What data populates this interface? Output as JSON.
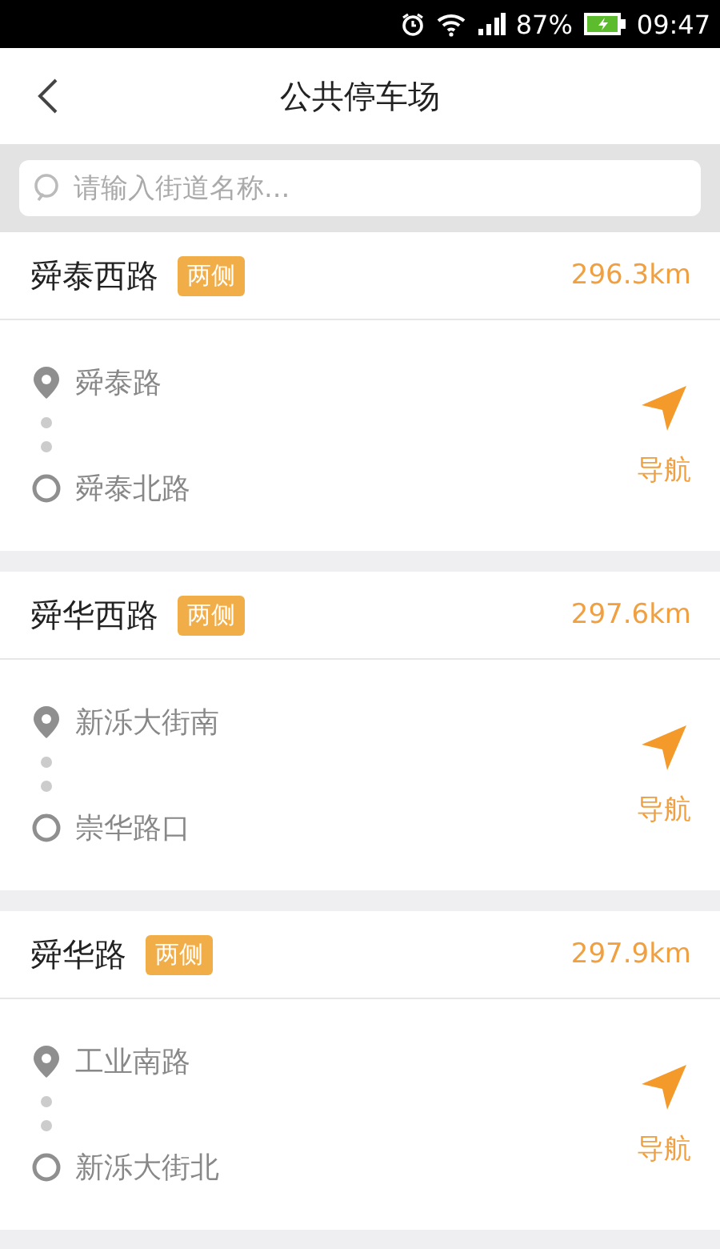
{
  "status_bar": {
    "battery": "87%",
    "time": "09:47"
  },
  "header": {
    "title": "公共停车场"
  },
  "search": {
    "placeholder": "请输入街道名称..."
  },
  "parkings": [
    {
      "name": "舜泰西路",
      "tag": "两侧",
      "distance": "296.3km",
      "start": "舜泰路",
      "end": "舜泰北路",
      "nav": "导航"
    },
    {
      "name": "舜华西路",
      "tag": "两侧",
      "distance": "297.6km",
      "start": "新泺大街南",
      "end": "崇华路口",
      "nav": "导航"
    },
    {
      "name": "舜华路",
      "tag": "两侧",
      "distance": "297.9km",
      "start": "工业南路",
      "end": "新泺大街北",
      "nav": "导航"
    }
  ]
}
